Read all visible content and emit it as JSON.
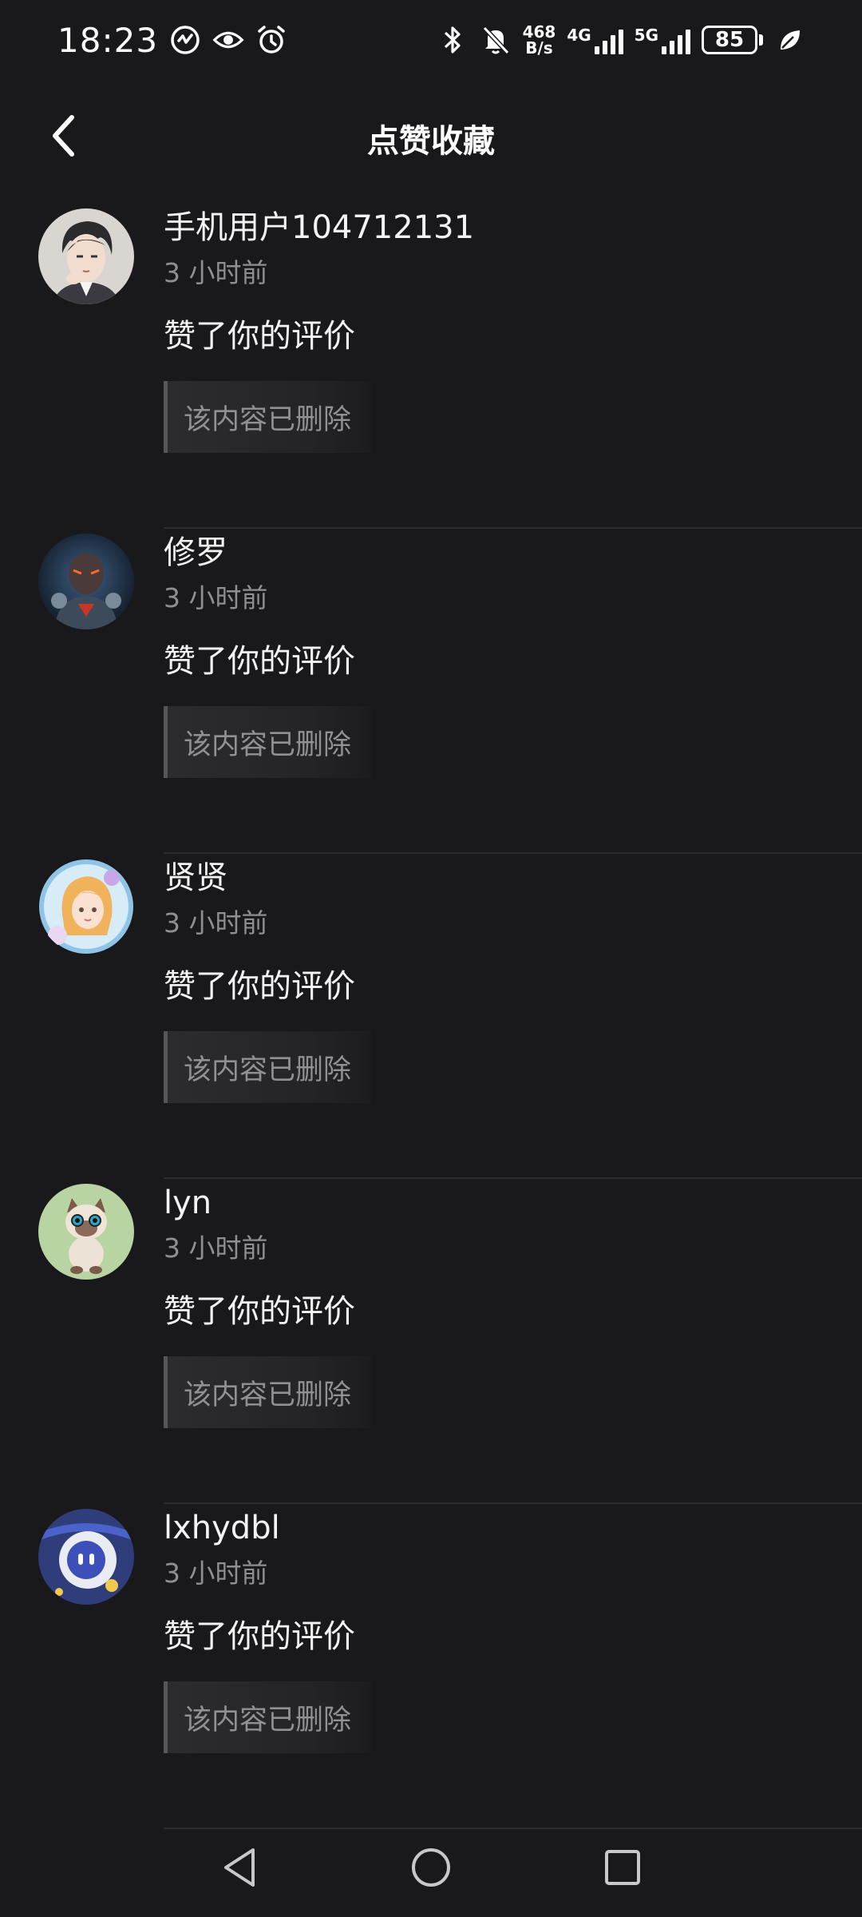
{
  "status_bar": {
    "time": "18:23",
    "speed_value": "468",
    "speed_unit": "B/s",
    "net1": "4G",
    "net2": "5G",
    "battery": "85"
  },
  "header": {
    "title": "点赞收藏"
  },
  "notifications": [
    {
      "username": "手机用户104712131",
      "time": "3 小时前",
      "action": "赞了你的评价",
      "quote": "该内容已删除",
      "avatar_icon": "avatar-anime-man"
    },
    {
      "username": "修罗",
      "time": "3 小时前",
      "action": "赞了你的评价",
      "quote": "该内容已删除",
      "avatar_icon": "avatar-armored-warrior"
    },
    {
      "username": "贤贤",
      "time": "3 小时前",
      "action": "赞了你的评价",
      "quote": "该内容已删除",
      "avatar_icon": "avatar-anime-girl"
    },
    {
      "username": "lyn",
      "time": "3 小时前",
      "action": "赞了你的评价",
      "quote": "该内容已删除",
      "avatar_icon": "avatar-cat"
    },
    {
      "username": "lxhydbl",
      "time": "3 小时前",
      "action": "赞了你的评价",
      "quote": "该内容已删除",
      "avatar_icon": "avatar-robot"
    }
  ],
  "colors": {
    "background": "#19191b",
    "text_primary": "#f3f3f3",
    "text_secondary": "#8f8f93"
  }
}
